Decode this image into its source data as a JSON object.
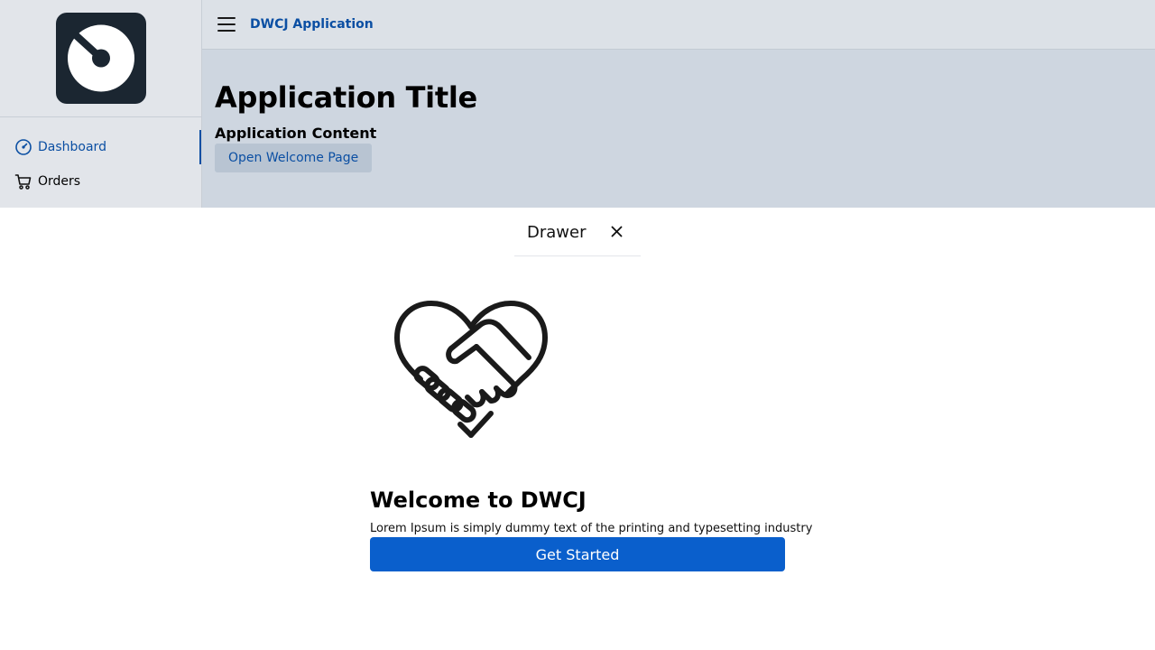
{
  "header": {
    "app_name": "DWCJ Application"
  },
  "sidebar": {
    "items": [
      {
        "label": "Dashboard",
        "icon": "dashboard-icon",
        "active": true
      },
      {
        "label": "Orders",
        "icon": "cart-icon",
        "active": false
      }
    ]
  },
  "main": {
    "title": "Application Title",
    "subheading": "Application Content",
    "open_button": "Open Welcome Page"
  },
  "drawer": {
    "title": "Drawer",
    "welcome_title": "Welcome to DWCJ",
    "welcome_text": "Lorem Ipsum is simply dummy text of the printing and typesetting industry",
    "cta_label": "Get Started"
  },
  "colors": {
    "accent": "#0b4fa3",
    "primary_button": "#0a5fcc",
    "sidebar_bg": "#e2e5ea",
    "content_bg": "#ced6e0"
  }
}
